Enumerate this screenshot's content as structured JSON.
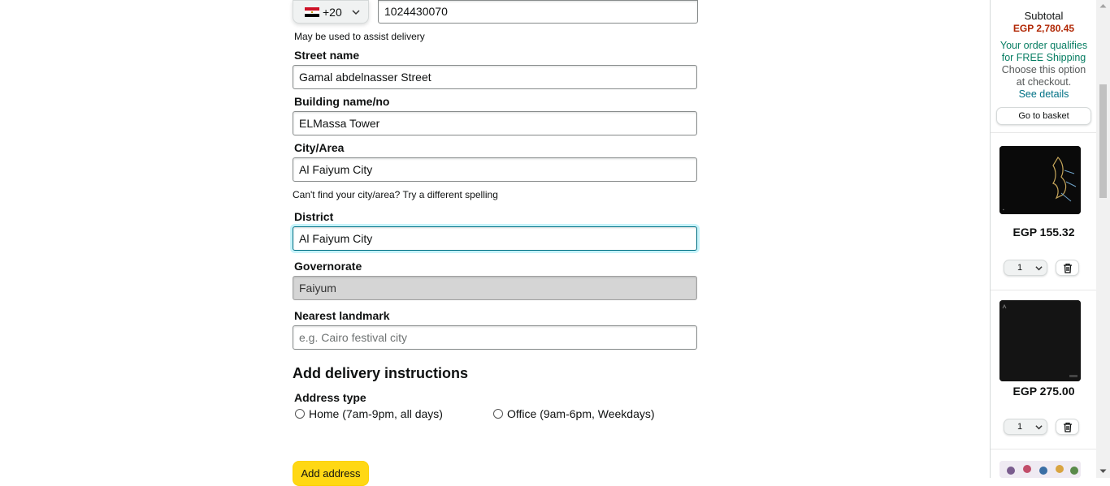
{
  "phone": {
    "country_code": "+20",
    "number": "1024430070",
    "hint": "May be used to assist delivery"
  },
  "fields": {
    "street": {
      "label": "Street name",
      "value": "Gamal abdelnasser Street"
    },
    "building": {
      "label": "Building name/no",
      "value": "ELMassa Tower"
    },
    "city": {
      "label": "City/Area",
      "value": "Al Faiyum City",
      "hint": "Can't find your city/area? Try a different spelling"
    },
    "district": {
      "label": "District",
      "value": "Al Faiyum City"
    },
    "governorate": {
      "label": "Governorate",
      "value": "Faiyum"
    },
    "landmark": {
      "label": "Nearest landmark",
      "value": "",
      "placeholder": "e.g. Cairo festival city"
    }
  },
  "delivery_instructions": {
    "heading": "Add delivery instructions",
    "address_type_label": "Address type",
    "options": [
      "Home (7am-9pm, all days)",
      "Office (9am-6pm, Weekdays)"
    ]
  },
  "add_address_label": "Add address",
  "sidebar": {
    "subtotal_label": "Subtotal",
    "subtotal_value": "EGP 2,780.45",
    "free_shipping_line1": "Your order qualifies",
    "free_shipping_line2": "for FREE Shipping",
    "choose_line1": "Choose this option",
    "choose_line2": "at checkout.",
    "see_details": "See details",
    "go_to_basket": "Go to basket",
    "items": [
      {
        "price": "EGP 155.32",
        "qty": "1"
      },
      {
        "price": "EGP 275.00",
        "qty": "1"
      }
    ]
  }
}
